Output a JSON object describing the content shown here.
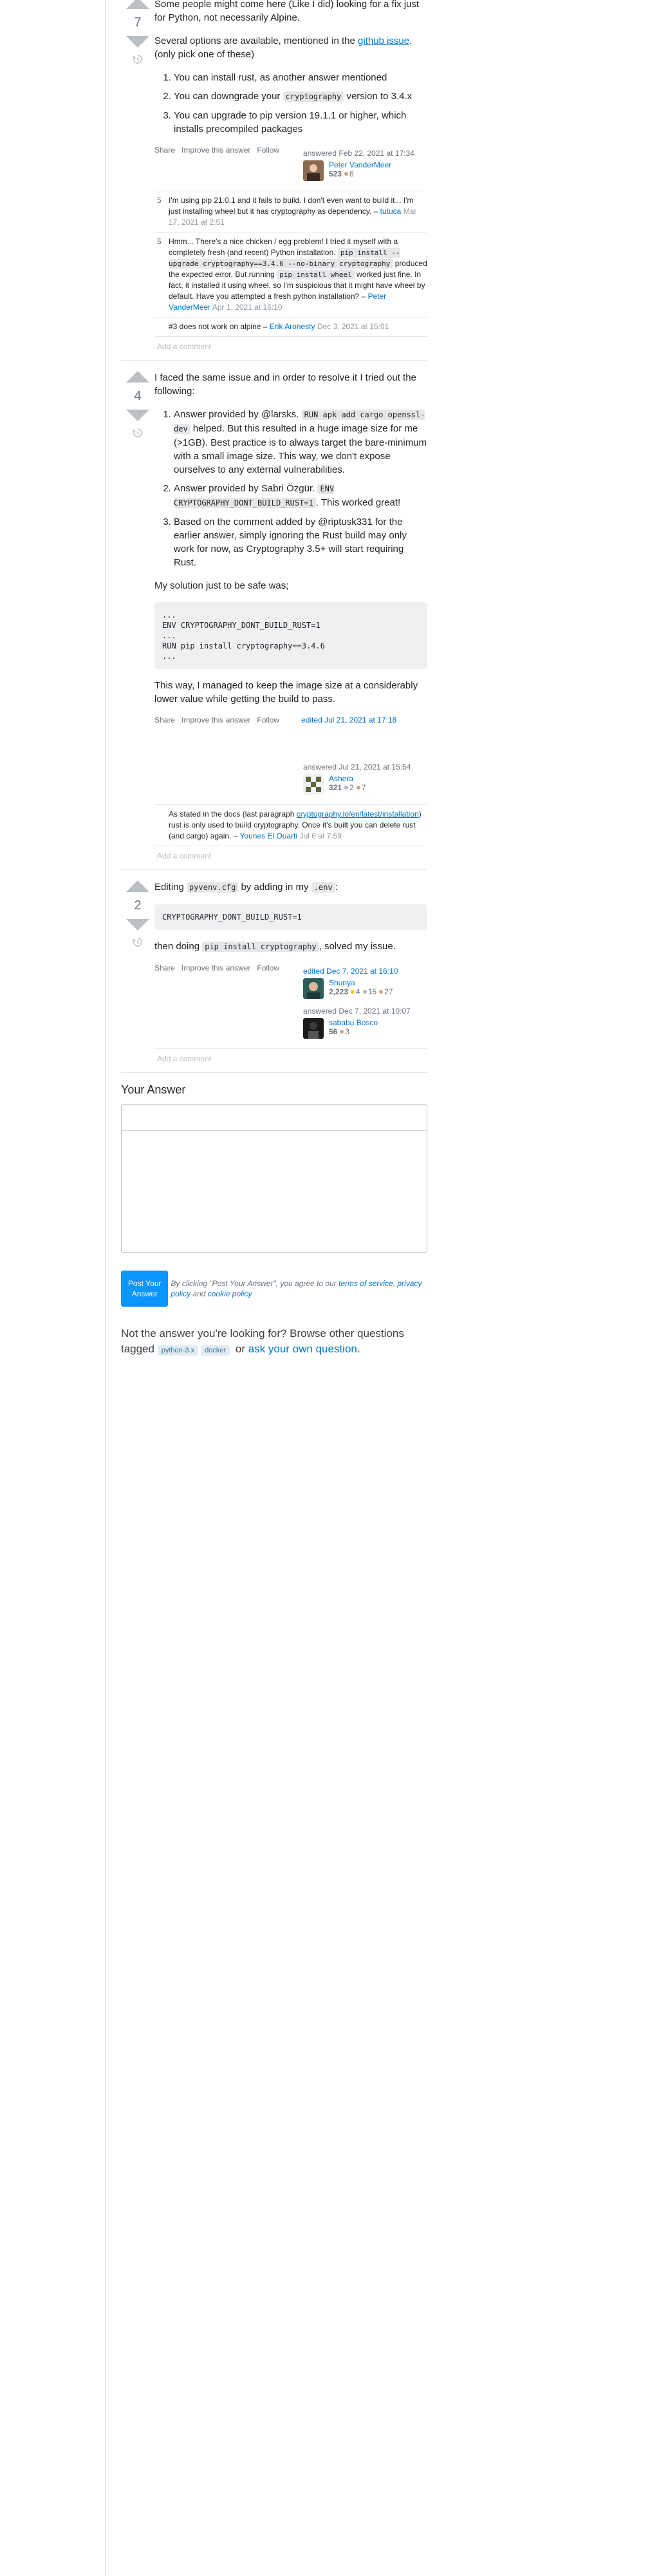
{
  "answer1": {
    "vote_count": "7",
    "p1": "Some people might come here (Like I did) looking for a fix just for Python, not necessarily Alpine.",
    "p2_prefix": "Several options are available, mentioned in the ",
    "p2_link": "github issue",
    "p2_suffix": ". (only pick one of these)",
    "list1": "You can install rust, as another answer mentioned",
    "list2_prefix": "You can downgrade your ",
    "list2_code": "cryptography",
    "list2_suffix": " version to 3.4.x",
    "list3": "You can upgrade to pip version 19.1.1 or higher, which installs precompiled packages",
    "menu": {
      "share": "Share",
      "improve": "Improve this answer",
      "follow": "Follow"
    },
    "signature": {
      "action": "answered Feb 22, 2021 at 17:34",
      "user": "Peter VanderMeer",
      "rep": "523",
      "bronze": "6"
    },
    "comments": [
      {
        "score": "5",
        "text": "I'm using pip 21.0.1 and it fails to build. I don't even want to build it... I'm just installing wheel but it has cryptography as dependency.",
        "user": "tutuca",
        "date": "Mar 17, 2021 at 2:51"
      },
      {
        "score": "5",
        "text_prefix": "Hmm... There's a nice chicken / egg problem! I tried it myself with a completely fresh (and recent) Python installation. ",
        "code1": "pip install --upgrade cryptography==3.4.6 --no-binary cryptography",
        "text_mid": " produced the expected error. But running ",
        "code2": "pip install wheel",
        "text_suffix": " worked just fine. In fact, it installed it using wheel, so I'm suspicious that it might have wheel by default. Have you attempted a fresh python installation?",
        "user": "Peter VanderMeer",
        "date": "Apr 1, 2021 at 16:10"
      },
      {
        "score": "",
        "text": "#3 does not work on alpine",
        "user": "Erik Aronesty",
        "date": "Dec 3, 2021 at 15:01"
      }
    ],
    "add_comment": "Add a comment"
  },
  "answer2": {
    "vote_count": "4",
    "p1": "I faced the same issue and in order to resolve it I tried out the following:",
    "item1_prefix": "Answer provided by @larsks. ",
    "item1_code": "RUN apk add cargo openssl-dev",
    "item1_suffix": " helped. But this resulted in a huge image size for me (>1GB). Best practice is to always target the bare-minimum with a small image size. This way, we don't expose ourselves to any external vulnerabilities.",
    "item2_prefix": "Answer provided by Sabri Özgür. ",
    "item2_code": "ENV CRYPTOGRAPHY_DONT_BUILD_RUST=1",
    "item2_suffix": ". This worked great!",
    "item3": "Based on the comment added by @riptusk331 for the earlier answer, simply ignoring the Rust build may only work for now, as Cryptography 3.5+ will start requiring Rust.",
    "p2": "My solution just to be safe was;",
    "code": "...\nENV CRYPTOGRAPHY_DONT_BUILD_RUST=1\n...\nRUN pip install cryptography==3.4.6\n...",
    "p3": "This way, I managed to keep the image size at a considerably lower value while getting the build to pass.",
    "menu": {
      "share": "Share",
      "improve": "Improve this answer",
      "follow": "Follow"
    },
    "edited": "edited Jul 21, 2021 at 17:18",
    "signature": {
      "action": "answered Jul 21, 2021 at 15:54",
      "user": "Ashera",
      "rep": "321",
      "silver": "2",
      "bronze": "7"
    },
    "comment": {
      "prefix": "As stated in the docs (last paragraph ",
      "link": "cryptography.io/en/latest/installation",
      "suffix": ") rust is only used to build cryptography. Once it's built you can delete rust (and cargo) again.",
      "user": "Younes El Ouarti",
      "date": "Jul 6 at 7:59"
    },
    "add_comment": "Add a comment"
  },
  "answer3": {
    "vote_count": "2",
    "p1_prefix": "Editing ",
    "p1_code1": "pyvenv.cfg",
    "p1_mid": " by adding in my ",
    "p1_code2": ".env",
    "p1_suffix": ":",
    "code": "CRYPTOGRAPHY_DONT_BUILD_RUST=1",
    "p2_prefix": "then doing ",
    "p2_code": "pip install cryptography",
    "p2_suffix": ", solved my issue.",
    "menu": {
      "share": "Share",
      "improve": "Improve this answer",
      "follow": "Follow"
    },
    "editor": {
      "action": "edited Dec 7, 2021 at 16:10",
      "user": "Shunya",
      "rep": "2,223",
      "gold": "4",
      "silver": "15",
      "bronze": "27"
    },
    "signature": {
      "action": "answered Dec 7, 2021 at 10:07",
      "user": "sababu Bosco",
      "rep": "56",
      "bronze": "3"
    },
    "add_comment": "Add a comment"
  },
  "your_answer": {
    "title": "Your Answer",
    "post_button": "Post Your Answer",
    "tos_prefix": "By clicking \"Post Your Answer\", you agree to our ",
    "tos_link": "terms of service",
    "tos_sep": ", ",
    "privacy_link": "privacy policy",
    "tos_and": " and ",
    "cookie_link": "cookie policy"
  },
  "footer_question": {
    "prefix": "Not the answer you're looking for? Browse other questions tagged ",
    "tag1": "python-3.x",
    "tag2": "docker",
    "or": " or ",
    "ask_link": "ask your own question",
    "period": "."
  },
  "colors": {
    "accent": "#0074cc",
    "button": "#0a95ff",
    "vote": "#bbc0c4"
  },
  "icons": {
    "history": "history-icon",
    "upvote": "upvote-icon",
    "downvote": "downvote-icon"
  }
}
